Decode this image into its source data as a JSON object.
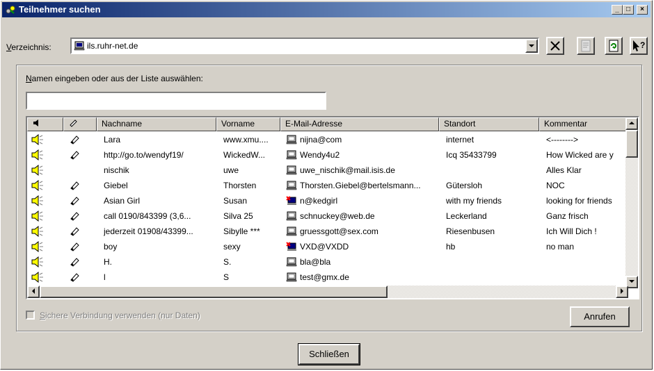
{
  "window": {
    "title": "Teilnehmer suchen",
    "minimize_glyph": "_",
    "maximize_glyph": "□",
    "close_glyph": "×"
  },
  "directory": {
    "label_accel": "V",
    "label_rest": "erzeichnis:",
    "value": "ils.ruhr-net.de",
    "icon": "server-icon"
  },
  "toolbar": [
    {
      "name": "delete-button",
      "icon": "x-icon"
    },
    {
      "name": "properties-button",
      "icon": "properties-icon"
    },
    {
      "name": "refresh-button",
      "icon": "refresh-icon"
    },
    {
      "name": "help-button",
      "icon": "help-pointer-icon"
    }
  ],
  "search": {
    "prompt_accel": "N",
    "prompt_rest": "amen eingeben oder aus der Liste auswählen:",
    "value": ""
  },
  "table": {
    "columns": [
      "",
      "",
      "Nachname",
      "Vorname",
      "E-Mail-Adresse",
      "Standort",
      "Kommentar"
    ],
    "rows": [
      {
        "audio": true,
        "video": true,
        "last": "Lara",
        "first": "www.xmu....",
        "email": "nijna@com",
        "email_icon": "computer",
        "loc": "internet",
        "comment": "<-------->"
      },
      {
        "audio": true,
        "video": true,
        "last": "http://go.to/wendyf19/",
        "first": "WickedW...",
        "email": "Wendy4u2",
        "email_icon": "computer",
        "loc": "Icq 35433799",
        "comment": "How Wicked are y"
      },
      {
        "audio": true,
        "video": false,
        "last": "nischik",
        "first": "uwe",
        "email": "uwe_nischik@mail.isis.de",
        "email_icon": "computer",
        "loc": "",
        "comment": "Alles Klar"
      },
      {
        "audio": true,
        "video": true,
        "last": "Giebel",
        "first": "Thorsten",
        "email": "Thorsten.Giebel@bertelsmann...",
        "email_icon": "computer",
        "loc": "Gütersloh",
        "comment": "NOC"
      },
      {
        "audio": true,
        "video": true,
        "last": "Asian Girl",
        "first": "Susan",
        "email": "n@kedgirl",
        "email_icon": "busy",
        "loc": "with my friends",
        "comment": "looking for friends"
      },
      {
        "audio": true,
        "video": true,
        "last": "call 0190/843399 (3,6...",
        "first": "Silva 25",
        "email": "schnuckey@web.de",
        "email_icon": "computer",
        "loc": "Leckerland",
        "comment": "Ganz frisch"
      },
      {
        "audio": true,
        "video": true,
        "last": "jederzeit 01908/43399...",
        "first": "Sibylle ***",
        "email": "gruessgott@sex.com",
        "email_icon": "computer",
        "loc": "Riesenbusen",
        "comment": "Ich Will Dich !"
      },
      {
        "audio": true,
        "video": true,
        "last": "boy",
        "first": "sexy",
        "email": "VXD@VXDD",
        "email_icon": "busy",
        "loc": "hb",
        "comment": "no man"
      },
      {
        "audio": true,
        "video": true,
        "last": "H.",
        "first": "S.",
        "email": "bla@bla",
        "email_icon": "computer",
        "loc": "",
        "comment": ""
      },
      {
        "audio": true,
        "video": true,
        "last": "l",
        "first": "S",
        "email": "test@gmx.de",
        "email_icon": "computer",
        "loc": "",
        "comment": ""
      }
    ]
  },
  "secure": {
    "label_accel": "S",
    "label_rest": "ichere Verbindung verwenden (nur Daten)",
    "checked": false
  },
  "buttons": {
    "call": "Anrufen",
    "close": "Schließen"
  }
}
